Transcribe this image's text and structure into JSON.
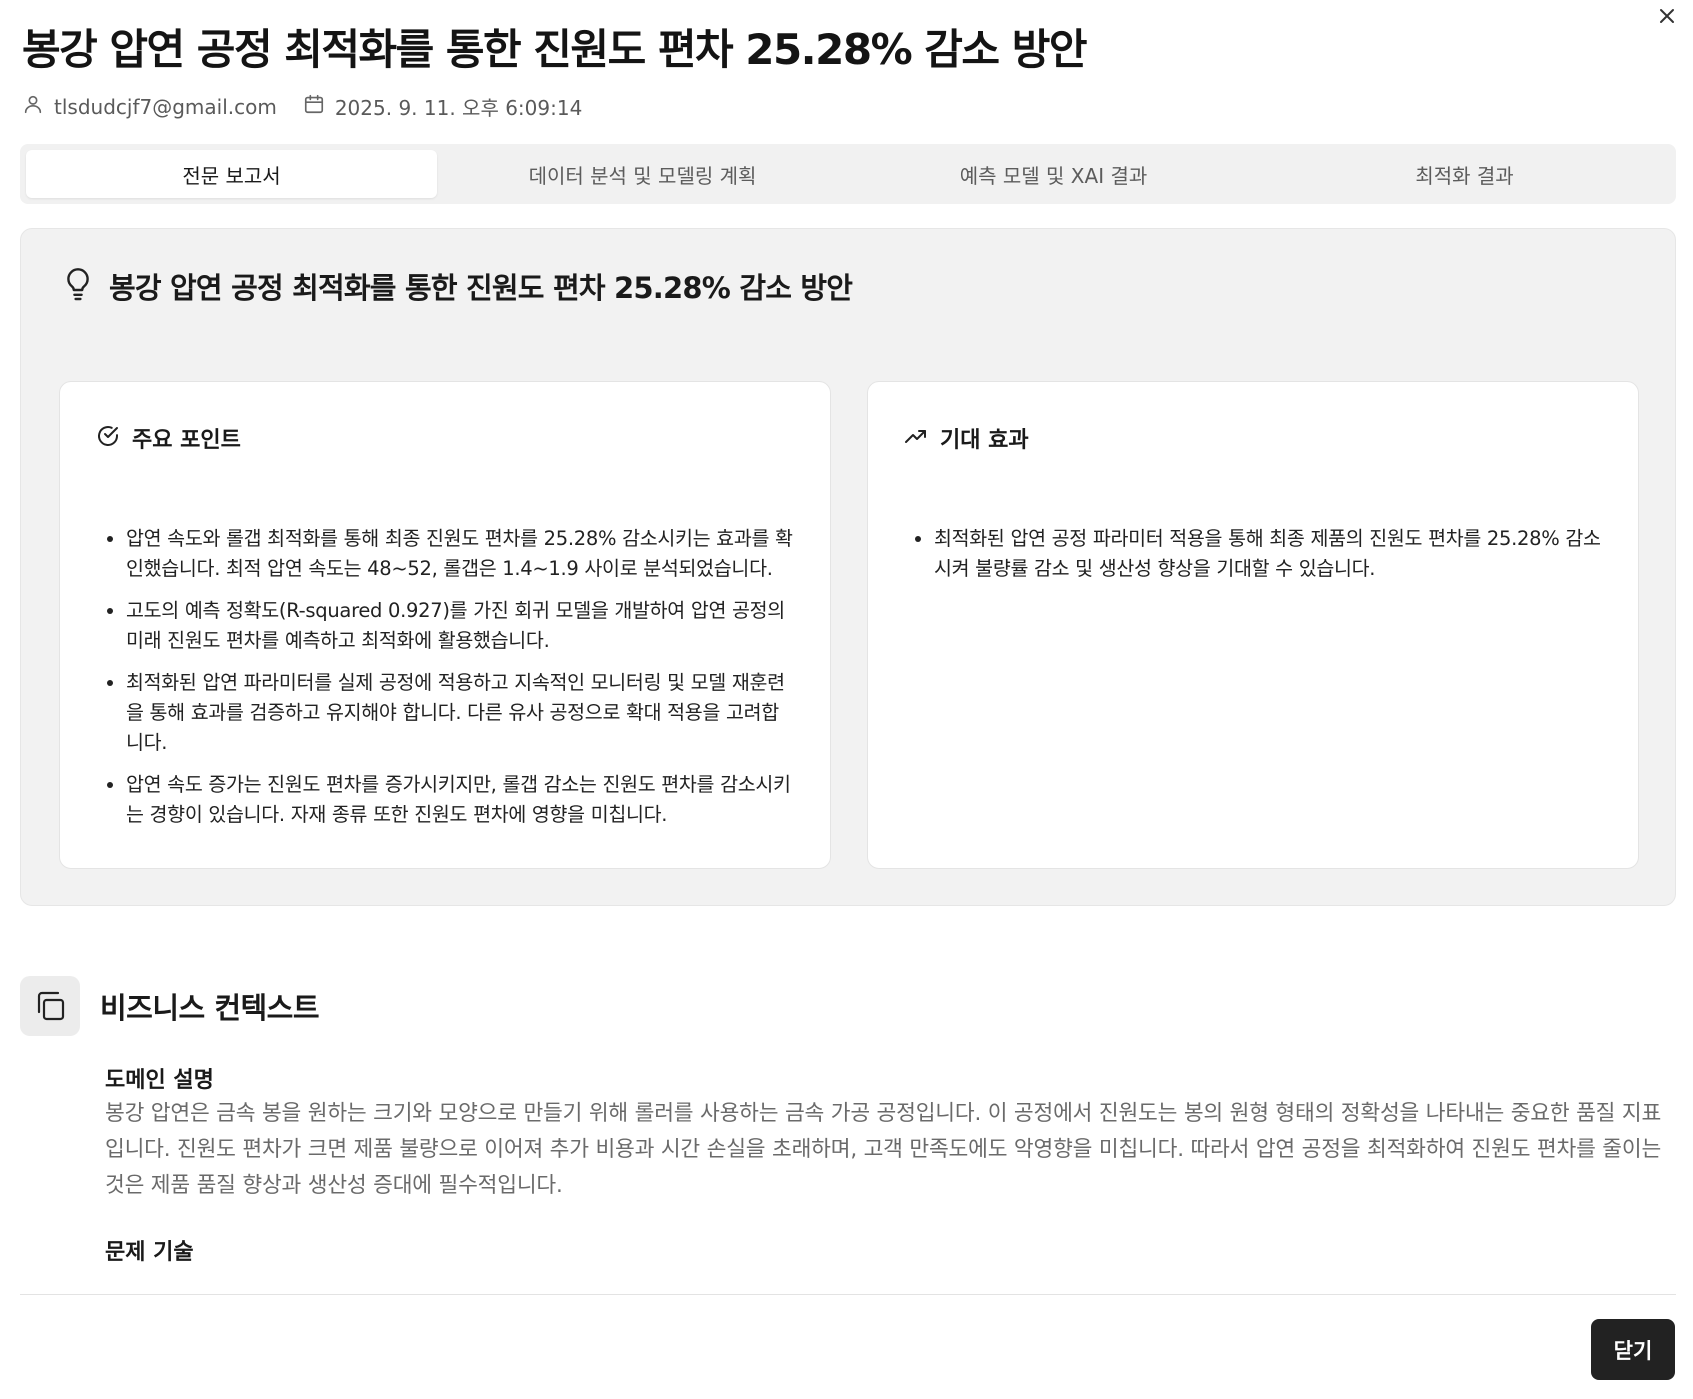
{
  "title": "봉강 압연 공정 최적화를 통한 진원도 편차 25.28% 감소 방안",
  "meta": {
    "author": "tlsdudcjf7@gmail.com",
    "date": "2025. 9. 11. 오후 6:09:14"
  },
  "tabs": [
    {
      "label": "전문 보고서",
      "active": true
    },
    {
      "label": "데이터 분석 및 모델링 계획",
      "active": false
    },
    {
      "label": "예측 모델 및 XAI 결과",
      "active": false
    },
    {
      "label": "최적화 결과",
      "active": false
    }
  ],
  "summary": {
    "heading": "봉강 압연 공정 최적화를 통한 진원도 편차 25.28% 감소 방안",
    "key_points": {
      "title": "주요 포인트",
      "items": [
        "압연 속도와 롤갭 최적화를 통해 최종 진원도 편차를 25.28% 감소시키는 효과를 확인했습니다. 최적 압연 속도는 48~52, 롤갭은 1.4~1.9 사이로 분석되었습니다.",
        "고도의 예측 정확도(R-squared 0.927)를 가진 회귀 모델을 개발하여 압연 공정의 미래 진원도 편차를 예측하고 최적화에 활용했습니다.",
        "최적화된 압연 파라미터를 실제 공정에 적용하고 지속적인 모니터링 및 모델 재훈련을 통해 효과를 검증하고 유지해야 합니다. 다른 유사 공정으로 확대 적용을 고려합니다.",
        "압연 속도 증가는 진원도 편차를 증가시키지만, 롤갭 감소는 진원도 편차를 감소시키는 경향이 있습니다. 자재 종류 또한 진원도 편차에 영향을 미칩니다."
      ]
    },
    "expected_effects": {
      "title": "기대 효과",
      "items": [
        "최적화된 압연 공정 파라미터 적용을 통해 최종 제품의 진원도 편차를 25.28% 감소시켜 불량률 감소 및 생산성 향상을 기대할 수 있습니다."
      ]
    }
  },
  "business_context": {
    "title": "비즈니스 컨텍스트",
    "domain_heading": "도메인 설명",
    "domain_text": "봉강 압연은 금속 봉을 원하는 크기와 모양으로 만들기 위해 롤러를 사용하는 금속 가공 공정입니다. 이 공정에서 진원도는 봉의 원형 형태의 정확성을 나타내는 중요한 품질 지표입니다. 진원도 편차가 크면 제품 불량으로 이어져 추가 비용과 시간 손실을 초래하며, 고객 만족도에도 악영향을 미칩니다. 따라서 압연 공정을 최적화하여 진원도 편차를 줄이는 것은 제품 품질 향상과 생산성 증대에 필수적입니다.",
    "problem_heading": "문제 기술"
  },
  "footer": {
    "close_label": "닫기"
  },
  "icons": {
    "close": "close-icon",
    "user": "user-icon",
    "calendar": "calendar-icon",
    "lightbulb": "lightbulb-icon",
    "check_circle": "check-circle-icon",
    "trending_up": "trending-up-icon",
    "copy": "copy-icon"
  }
}
